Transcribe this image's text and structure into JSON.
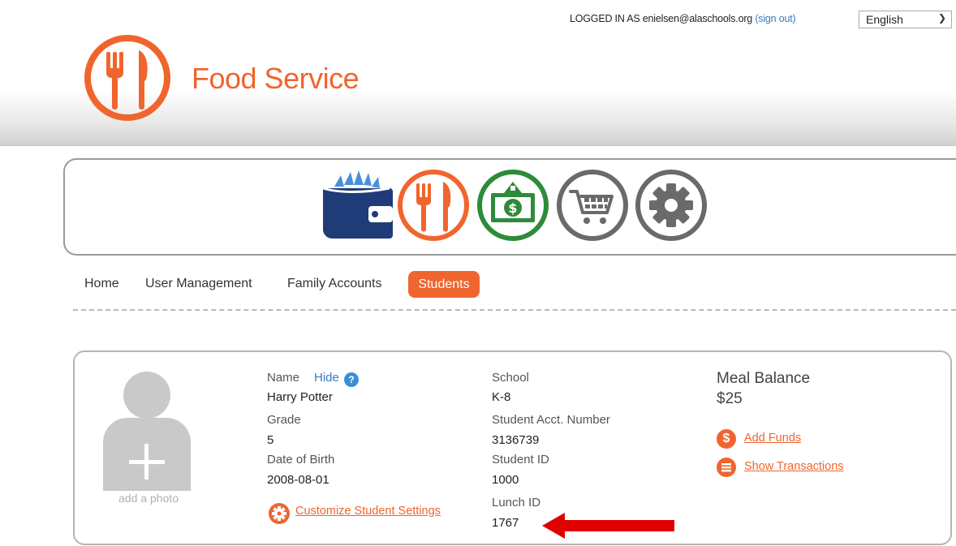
{
  "header": {
    "login_prefix": "LOGGED IN AS enielsen@alaschools.org",
    "sign_out": "(sign out)",
    "language": "English",
    "app_title": "Food Service"
  },
  "modules": [
    {
      "name": "wallet-books",
      "icon": "wallet-icon",
      "color": "#1f3c78"
    },
    {
      "name": "food-service",
      "icon": "fork-knife-icon",
      "color": "#f0652e"
    },
    {
      "name": "payments",
      "icon": "money-icon",
      "color": "#2e8b3a"
    },
    {
      "name": "store",
      "icon": "cart-icon",
      "color": "#666666"
    },
    {
      "name": "settings",
      "icon": "gear-icon",
      "color": "#666666"
    }
  ],
  "nav": {
    "home": "Home",
    "user_management": "User Management",
    "family_accounts": "Family Accounts",
    "students": "Students"
  },
  "student": {
    "add_photo": "add a photo",
    "name_label": "Name",
    "hide_link": "Hide",
    "name": "Harry Potter",
    "grade_label": "Grade",
    "grade": "5",
    "dob_label": "Date of Birth",
    "dob": "2008-08-01",
    "customize_link": "Customize Student Settings",
    "school_label": "School",
    "school": "K-8",
    "acct_label": "Student Acct. Number",
    "acct": "3136739",
    "student_id_label": "Student ID",
    "student_id": "1000",
    "lunch_id_label": "Lunch ID",
    "lunch_id": "1767",
    "meal_balance_label": "Meal Balance",
    "meal_balance": "$25",
    "add_funds": "Add Funds",
    "show_transactions": "Show Transactions"
  },
  "colors": {
    "brand_orange": "#f0652e",
    "link_blue": "#3a7abf",
    "annotation_red": "#e00000"
  }
}
